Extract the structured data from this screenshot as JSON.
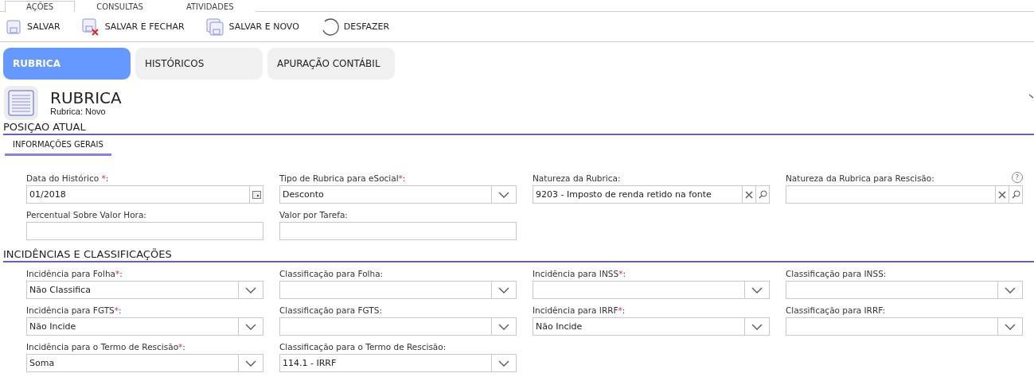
{
  "top_tabs": [
    {
      "label": "AÇÕES",
      "selected": true
    },
    {
      "label": "CONSULTAS",
      "selected": false
    },
    {
      "label": "ATIVIDADES",
      "selected": false
    }
  ],
  "toolbar": [
    {
      "kind": "save",
      "label": "SALVAR"
    },
    {
      "kind": "save_close",
      "label": "SALVAR E FECHAR"
    },
    {
      "kind": "save_new",
      "label": "SALVAR E NOVO"
    },
    {
      "kind": "undo",
      "label": "DESFAZER"
    }
  ],
  "page_tabs": [
    {
      "label": "RUBRICA",
      "selected": true
    },
    {
      "label": "HISTÓRICOS",
      "selected": false
    },
    {
      "label": "APURAÇÃO CONTÁBIL",
      "selected": false
    }
  ],
  "header": {
    "title": "RUBRICA",
    "subtitle": "Rubrica: Novo"
  },
  "sections": [
    {
      "title": "POSIÇAO ATUAL",
      "subtabs": [
        {
          "label": "INFORMAÇÕES GERAIS",
          "selected": true
        }
      ],
      "rows": [
        [
          {
            "kind": "date",
            "label": "Data do Histórico ",
            "required_mark": "*",
            "label_end": ":",
            "value": "01/2018"
          },
          {
            "kind": "select",
            "label": "Tipo de Rubrica para eSocial",
            "required_mark": "*",
            "label_end": ":",
            "value": "Desconto"
          },
          {
            "kind": "lookup",
            "label": "Natureza da Rubrica:",
            "value": "9203 - Imposto de renda retido na fonte"
          },
          {
            "kind": "lookup",
            "label": "Natureza da Rubrica para Rescisão:",
            "help": "?"
          }
        ],
        [
          {
            "kind": "text",
            "label": "Percentual Sobre Valor Hora:"
          },
          {
            "kind": "text",
            "label": "Valor por Tarefa:"
          }
        ]
      ]
    },
    {
      "title": "INCIDÊNCIAS E CLASSIFICAÇÕES",
      "rows": [
        [
          {
            "kind": "select",
            "label": "Incidência para Folha",
            "required_mark": "*",
            "label_end": ":",
            "value": "Não Classifica"
          },
          {
            "kind": "select",
            "label": "Classificação para Folha:"
          },
          {
            "kind": "select",
            "label": "Incidência para INSS",
            "required_mark": "*",
            "label_end": ":"
          },
          {
            "kind": "select",
            "label": "Classificação para INSS:"
          }
        ],
        [
          {
            "kind": "select",
            "label": "Incidência para FGTS",
            "required_mark": "*",
            "label_end": ":",
            "value": "Não Incide"
          },
          {
            "kind": "select",
            "label": "Classificação para FGTS:"
          },
          {
            "kind": "select",
            "label": "Incidência para IRRF",
            "required_mark": "*",
            "label_end": ":",
            "value": "Não Incide"
          },
          {
            "kind": "select",
            "label": "Classificação para IRRF:"
          }
        ],
        [
          {
            "kind": "select",
            "label": "Incidência para o Termo de Rescisão",
            "required_mark": "*",
            "label_end": ":",
            "value": "Soma"
          },
          {
            "kind": "select",
            "label": "Classificação para o Termo de Rescisão:",
            "value": "114.1 - IRRF"
          }
        ]
      ]
    }
  ]
}
